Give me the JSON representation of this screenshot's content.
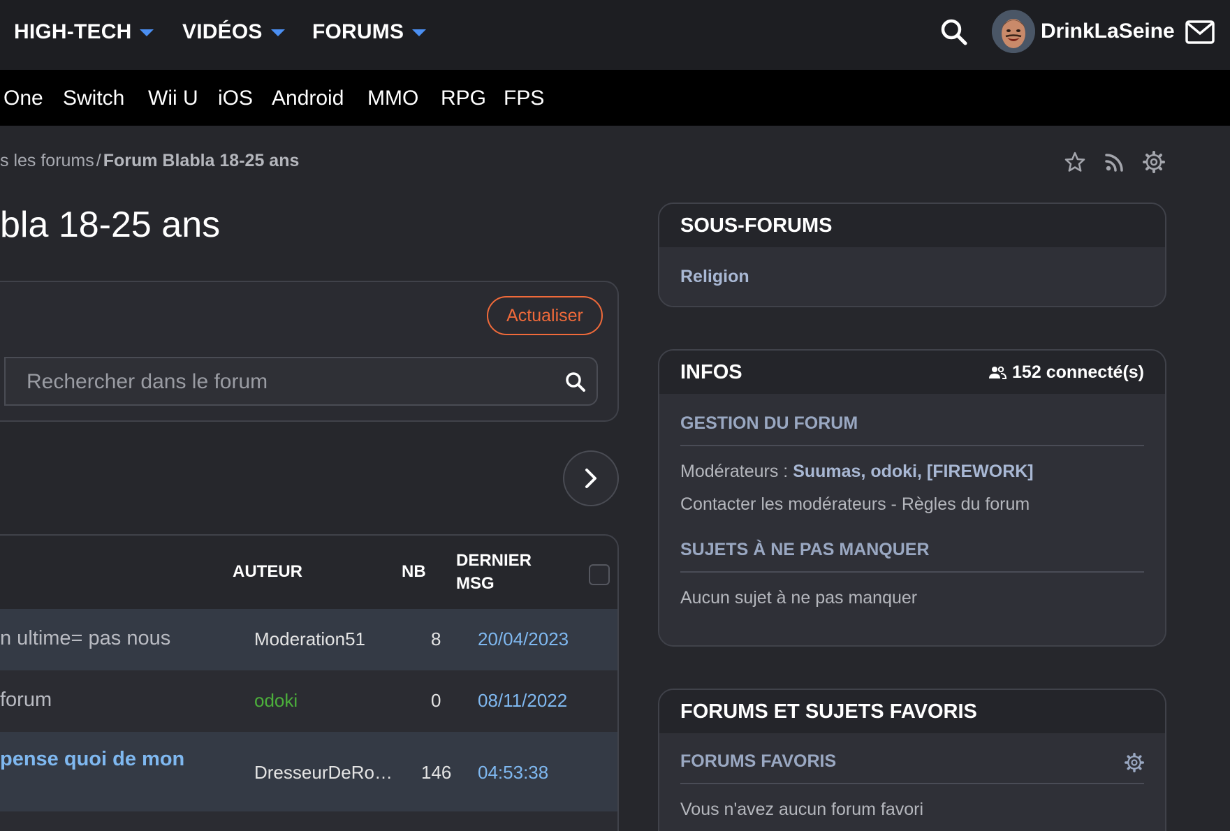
{
  "topnav": {
    "items": [
      {
        "label": "HIGH-TECH"
      },
      {
        "label": "VIDÉOS"
      },
      {
        "label": "FORUMS"
      }
    ],
    "username": "DrinkLaSeine"
  },
  "platforms": [
    "One",
    "Switch",
    "Wii U",
    "iOS",
    "Android",
    "MMO",
    "RPG",
    "FPS"
  ],
  "breadcrumb": {
    "parent": "s les forums",
    "separator": "/",
    "current": "Forum Blabla 18-25 ans"
  },
  "page_title": "bla 18-25 ans",
  "toolbar": {
    "refresh_label": "Actualiser",
    "search_placeholder": "Rechercher dans le forum"
  },
  "table": {
    "headers": {
      "author": "AUTEUR",
      "count": "NB",
      "last_msg_line1": "DERNIER",
      "last_msg_line2": "MSG"
    },
    "rows": [
      {
        "title": "n ultime= pas nous",
        "author": "Moderation51",
        "count": "8",
        "last": "20/04/2023"
      },
      {
        "title": "forum",
        "author": "odoki",
        "count": "0",
        "last": "08/11/2022"
      },
      {
        "title": " pense quoi de mon",
        "author": "DresseurDeRo…",
        "count": "146",
        "last": "04:53:38"
      }
    ]
  },
  "sidebar": {
    "subforums": {
      "title": "SOUS-FORUMS",
      "items": [
        "Religion"
      ]
    },
    "infos": {
      "title": "INFOS",
      "connected": "152 connecté(s)",
      "management_title": "GESTION DU FORUM",
      "moderators_label": "Modérateurs : ",
      "moderators": "Suumas, odoki, [FIREWORK]",
      "contact_label": "Contacter les modérateurs",
      "dash": " - ",
      "rules_label": "Règles du forum",
      "must_see_title": "SUJETS À NE PAS MANQUER",
      "must_see_empty": "Aucun sujet à ne pas manquer"
    },
    "favorites": {
      "title": "FORUMS ET SUJETS FAVORIS",
      "forums_title": "FORUMS FAVORIS",
      "forums_empty": "Vous n'avez aucun forum favori"
    }
  },
  "colors": {
    "accent_blue": "#4b8ff2",
    "refresh_orange": "#f06a3a",
    "link_blue": "#7fb8f0",
    "moderator_green": "#4caf3b"
  }
}
